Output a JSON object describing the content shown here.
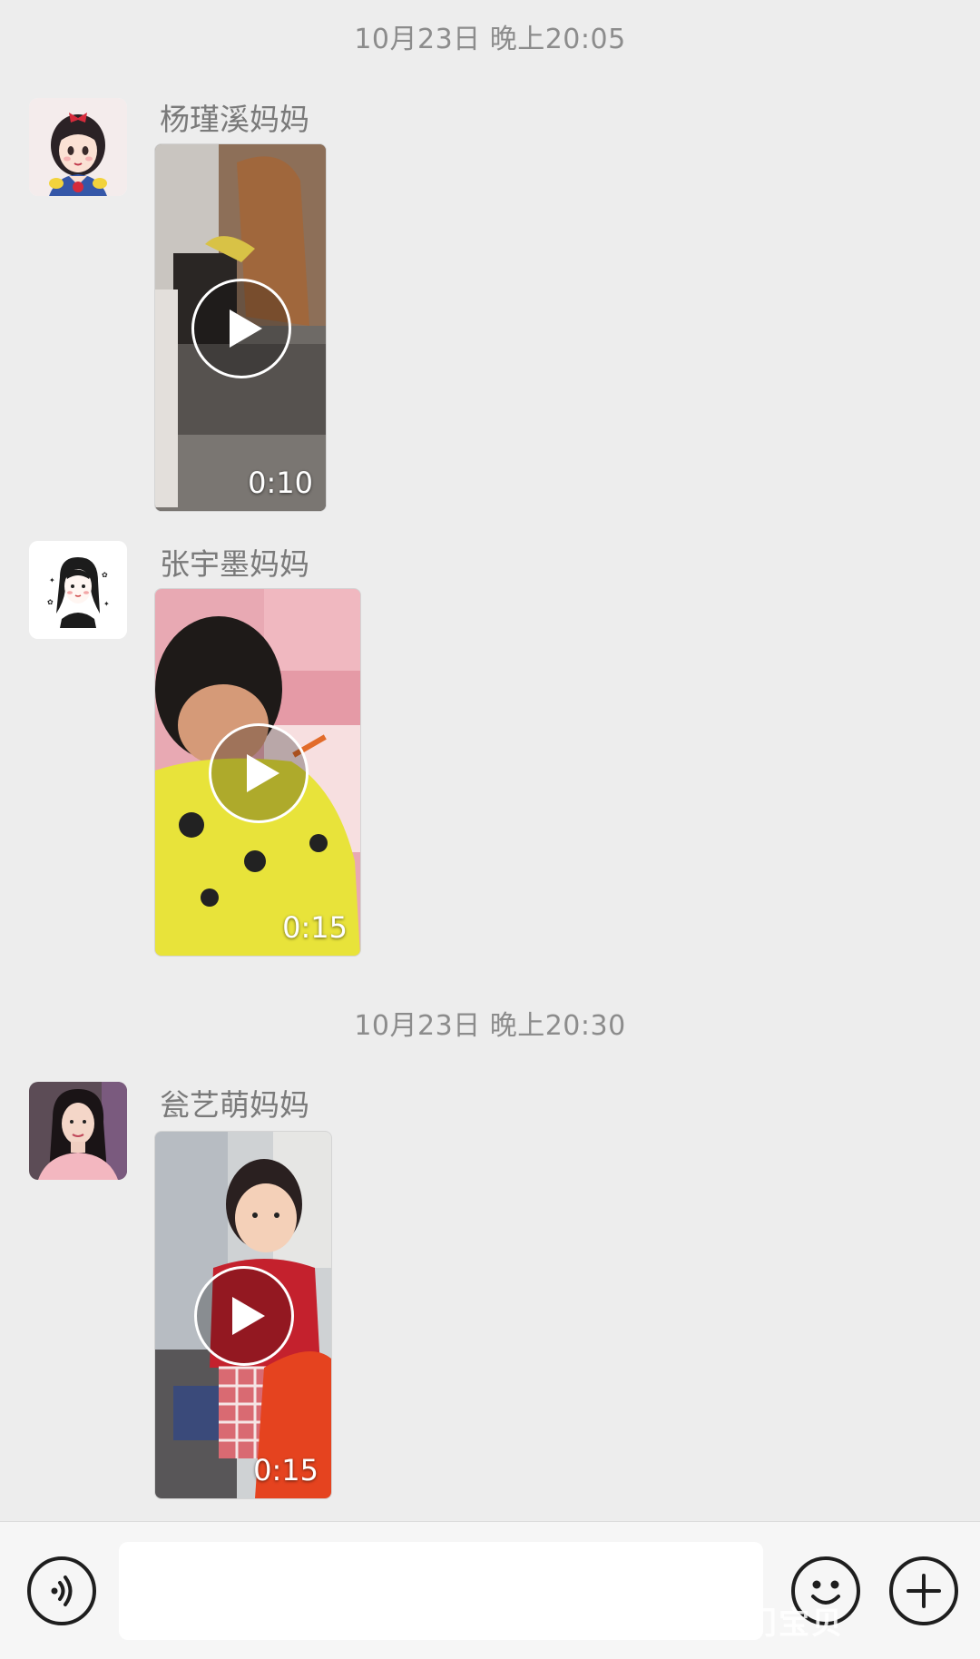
{
  "chat": {
    "groups": [
      {
        "timestamp": "10月23日 晚上20:05",
        "messages": [
          {
            "sender": "杨瑾溪妈妈",
            "avatar": "snow-white-avatar",
            "type": "video",
            "duration": "0:10"
          },
          {
            "sender": "张宇墨妈妈",
            "avatar": "sketch-girl-avatar",
            "type": "video",
            "duration": "0:15"
          }
        ]
      },
      {
        "timestamp": "10月23日 晚上20:30",
        "messages": [
          {
            "sender": "瓮艺萌妈妈",
            "avatar": "photo-woman-avatar",
            "type": "video",
            "duration": "0:15"
          }
        ]
      }
    ]
  },
  "input_bar": {
    "voice_icon": "voice-icon",
    "text_value": "",
    "emoji_icon": "emoji-icon",
    "more_icon": "plus-icon"
  },
  "watermark": {
    "text": "家门宝贝"
  },
  "colors": {
    "background": "#ededed",
    "timestamp": "#8c8c8c",
    "sender": "#7a7a7a",
    "input_bar": "#f6f6f6"
  }
}
